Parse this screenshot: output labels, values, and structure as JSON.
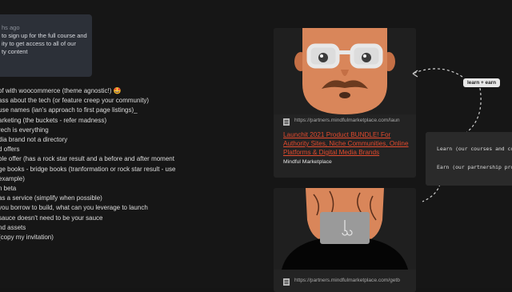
{
  "comment": {
    "time": "hs ago",
    "text": "to sign up for the full course and\nity to get access to all of our\nty content"
  },
  "notes": [
    "of with woocommerce  (theme agnostic!) 🤩",
    "ass about the tech (or feature creep your community)",
    "use names (ian's approach to first page listings)_",
    "arketing (the buckets - refer madness)",
    "rech is everything",
    "dia brand not a directory",
    "d offers",
    "ble offer  (has a rock star result and a before and after moment",
    "ge books - bridge books (tranformation or rock star result - use",
    "example)",
    "n beta",
    "as a service (simplify when possible)",
    "you borrow to build, what can you leverage to launch",
    "sauce doesn't need to be your sauce",
    "nd assets",
    "(copy my invitation)"
  ],
  "cards": [
    {
      "url": "https://partners.mindfulmarketplace.com/laun",
      "title": "Launchit 2021 Product BUNDLE! For Authority Sites, Niche Communities, Online Platforms & Digital Media Brands",
      "source": "Mindful Marketplace",
      "icons": {
        "image": "cartoon-man-glasses-mustache",
        "favicon": "page-icon"
      }
    },
    {
      "url": "https://partners.mindfulmarketplace.com/getb",
      "icons": {
        "image": "cartoon-person-laptop",
        "favicon": "page-icon"
      }
    }
  ],
  "tag": {
    "label": "learn + earn"
  },
  "code": {
    "line1": "Learn (our courses and co",
    "line2": "Earn (our partnership pro"
  },
  "colors": {
    "background": "#161616",
    "card": "#232323",
    "link": "#e24a2d",
    "comment_bg": "#2c3038"
  }
}
